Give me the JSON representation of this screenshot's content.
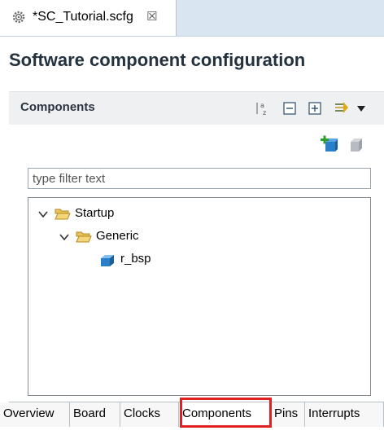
{
  "editor_tab": {
    "title": "*SC_Tutorial.scfg",
    "close_glyph": "☒",
    "icon": "gear-icon"
  },
  "page_title": "Software component configuration",
  "components_section": {
    "title": "Components",
    "toolbar": [
      "sort-az-icon",
      "collapse-all-icon",
      "expand-all-icon",
      "sync-icon",
      "view-menu-icon"
    ]
  },
  "actions": [
    "add-component-icon",
    "remove-component-icon"
  ],
  "filter": {
    "placeholder": "type filter text",
    "value": ""
  },
  "tree": {
    "root": {
      "label": "Startup",
      "expanded": true,
      "child": {
        "label": "Generic",
        "expanded": true,
        "leaf": {
          "label": "r_bsp"
        }
      }
    }
  },
  "page_tabs": [
    {
      "label": "Overview"
    },
    {
      "label": "Board"
    },
    {
      "label": "Clocks"
    },
    {
      "label": "Components"
    },
    {
      "label": "Pins"
    },
    {
      "label": "Interrupts"
    }
  ],
  "active_tab": "Components",
  "colors": {
    "highlight": "#e02020",
    "accent_folder": "#e8b543",
    "title_text": "#24323f"
  }
}
